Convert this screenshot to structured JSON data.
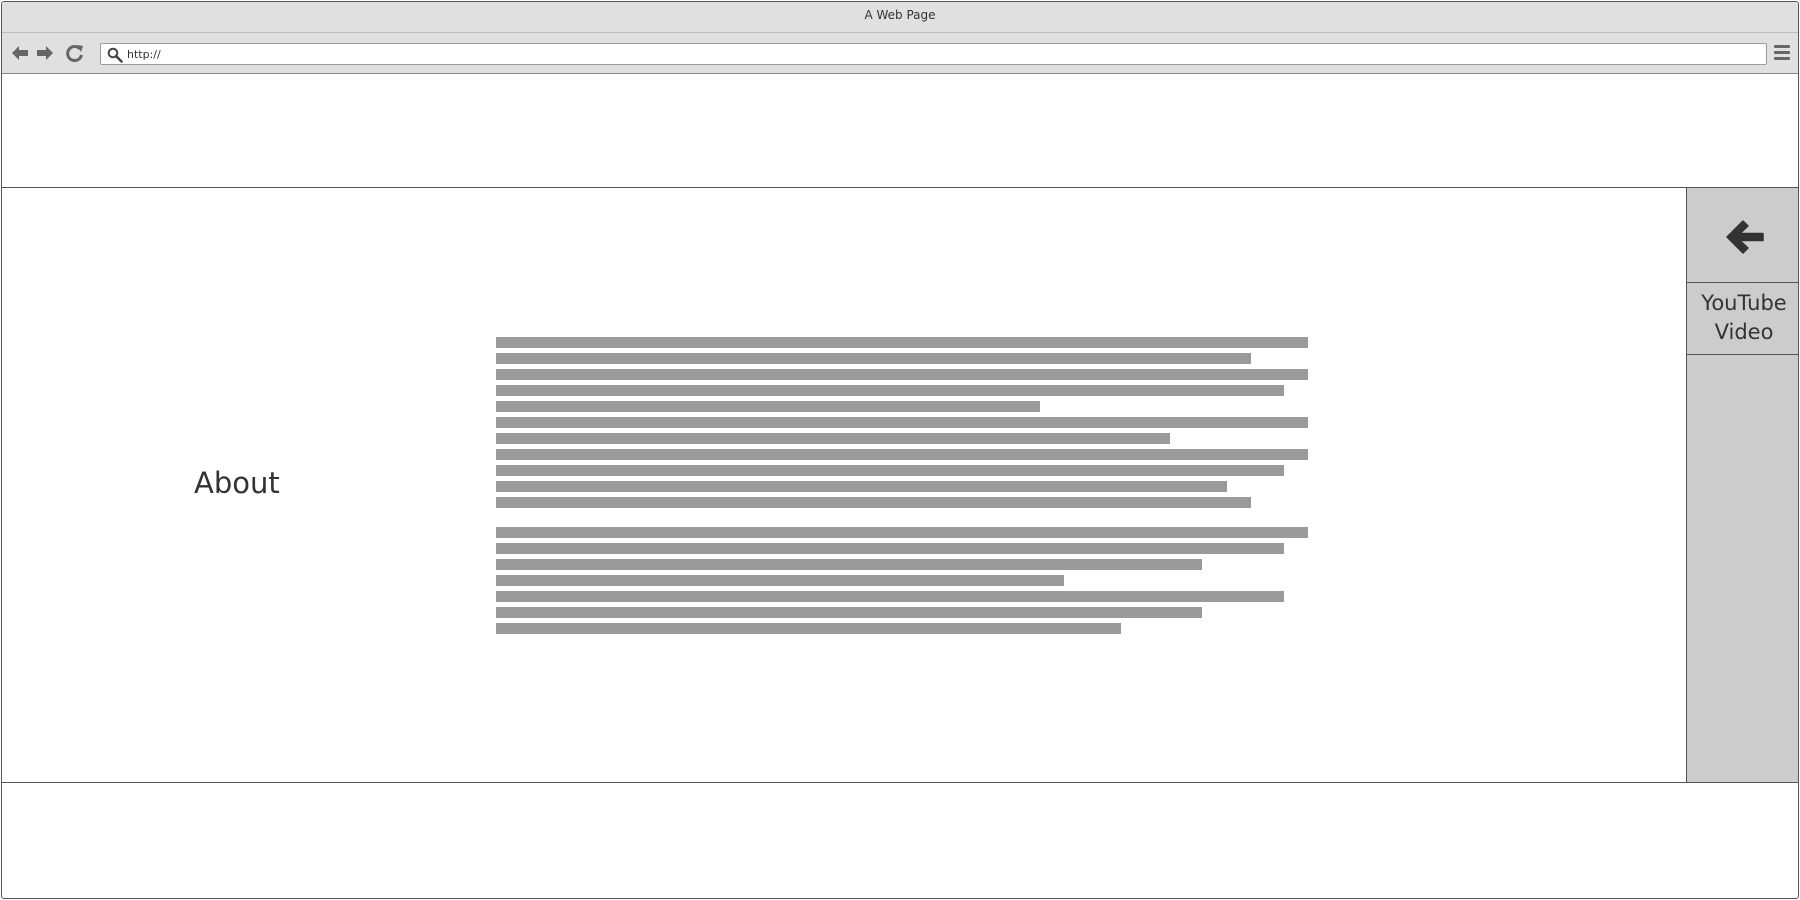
{
  "window": {
    "title": "A Web Page"
  },
  "toolbar": {
    "back_icon": "arrow-left-icon",
    "forward_icon": "arrow-right-icon",
    "reload_icon": "reload-icon",
    "search_icon": "search-icon",
    "menu_icon": "hamburger-menu-icon",
    "url_value": "http://"
  },
  "main": {
    "heading": "About",
    "paragraphs": [
      {
        "line_lengths_percent": [
          100,
          93,
          100,
          97,
          67,
          100,
          83,
          100,
          97,
          90,
          93
        ]
      },
      {
        "line_lengths_percent": [
          100,
          97,
          87,
          70,
          97,
          87,
          77
        ]
      }
    ]
  },
  "sidebar": {
    "back_icon": "arrow-left-icon",
    "link_label_line1": "YouTube",
    "link_label_line2": "Video"
  },
  "colors": {
    "chrome_bg": "#e0e0e0",
    "sidebar_bg": "#cccccc",
    "text_placeholder": "#9a9a9a",
    "border": "#555555",
    "text": "#333333"
  }
}
